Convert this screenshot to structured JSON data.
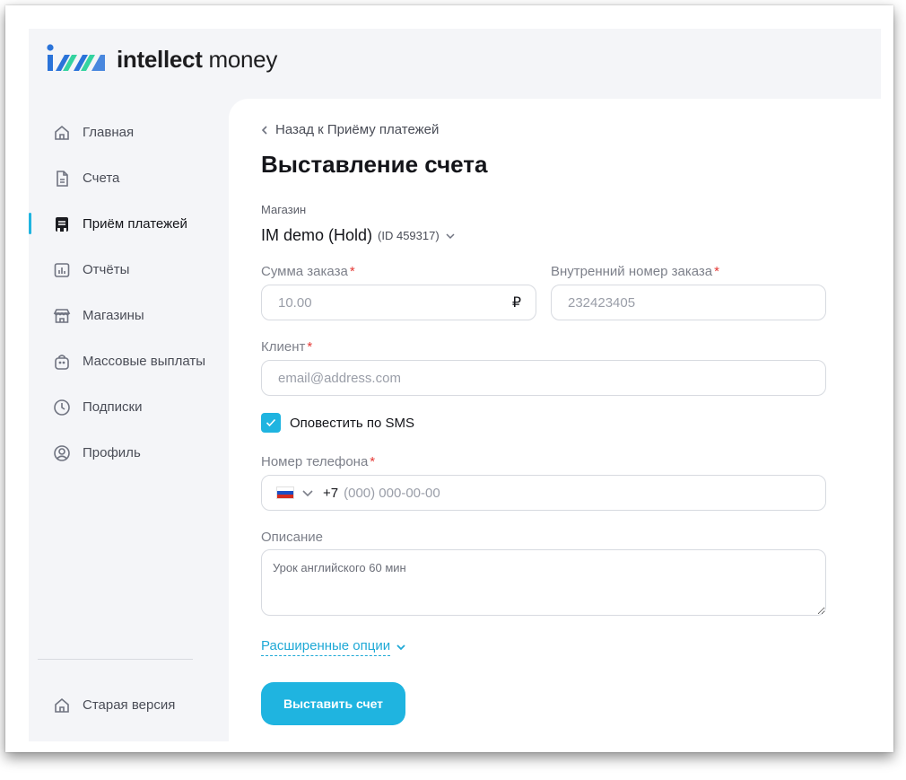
{
  "brand": {
    "name_bold": "intellect",
    "name_regular": " money",
    "colors": {
      "blue": "#2a73d9",
      "green": "#34d3a0",
      "accent": "#1fb4e0"
    }
  },
  "sidebar": {
    "items": [
      {
        "label": "Главная",
        "icon": "home-icon"
      },
      {
        "label": "Счета",
        "icon": "document-icon"
      },
      {
        "label": "Приём платежей",
        "icon": "terminal-icon",
        "active": true
      },
      {
        "label": "Отчёты",
        "icon": "chart-icon"
      },
      {
        "label": "Магазины",
        "icon": "store-icon"
      },
      {
        "label": "Массовые выплаты",
        "icon": "bag-icon"
      },
      {
        "label": "Подписки",
        "icon": "clock-icon"
      },
      {
        "label": "Профиль",
        "icon": "user-icon"
      }
    ],
    "old_version": {
      "label": "Старая версия",
      "icon": "home-icon"
    }
  },
  "page": {
    "back_link": "Назад к Приёму платежей",
    "title": "Выставление счета"
  },
  "form": {
    "shop": {
      "label": "Магазин",
      "name": "IM demo (Hold)",
      "id": "(ID 459317)"
    },
    "amount": {
      "label": "Сумма заказа",
      "required": "*",
      "placeholder": "10.00",
      "currency": "₽"
    },
    "order_number": {
      "label": "Внутренний номер заказа",
      "required": "*",
      "placeholder": "232423405"
    },
    "client": {
      "label": "Клиент",
      "required": "*",
      "placeholder": "email@address.com"
    },
    "sms_notify": {
      "label": "Оповестить по SMS",
      "checked": true
    },
    "phone": {
      "label": "Номер телефона",
      "required": "*",
      "country_code": "+7",
      "placeholder": "(000) 000-00-00",
      "flag": "russia-flag-icon"
    },
    "description": {
      "label": "Описание",
      "placeholder": "Урок английского 60 мин"
    },
    "advanced": {
      "label": "Расширенные опции"
    },
    "submit": {
      "label": "Выставить счет"
    }
  }
}
